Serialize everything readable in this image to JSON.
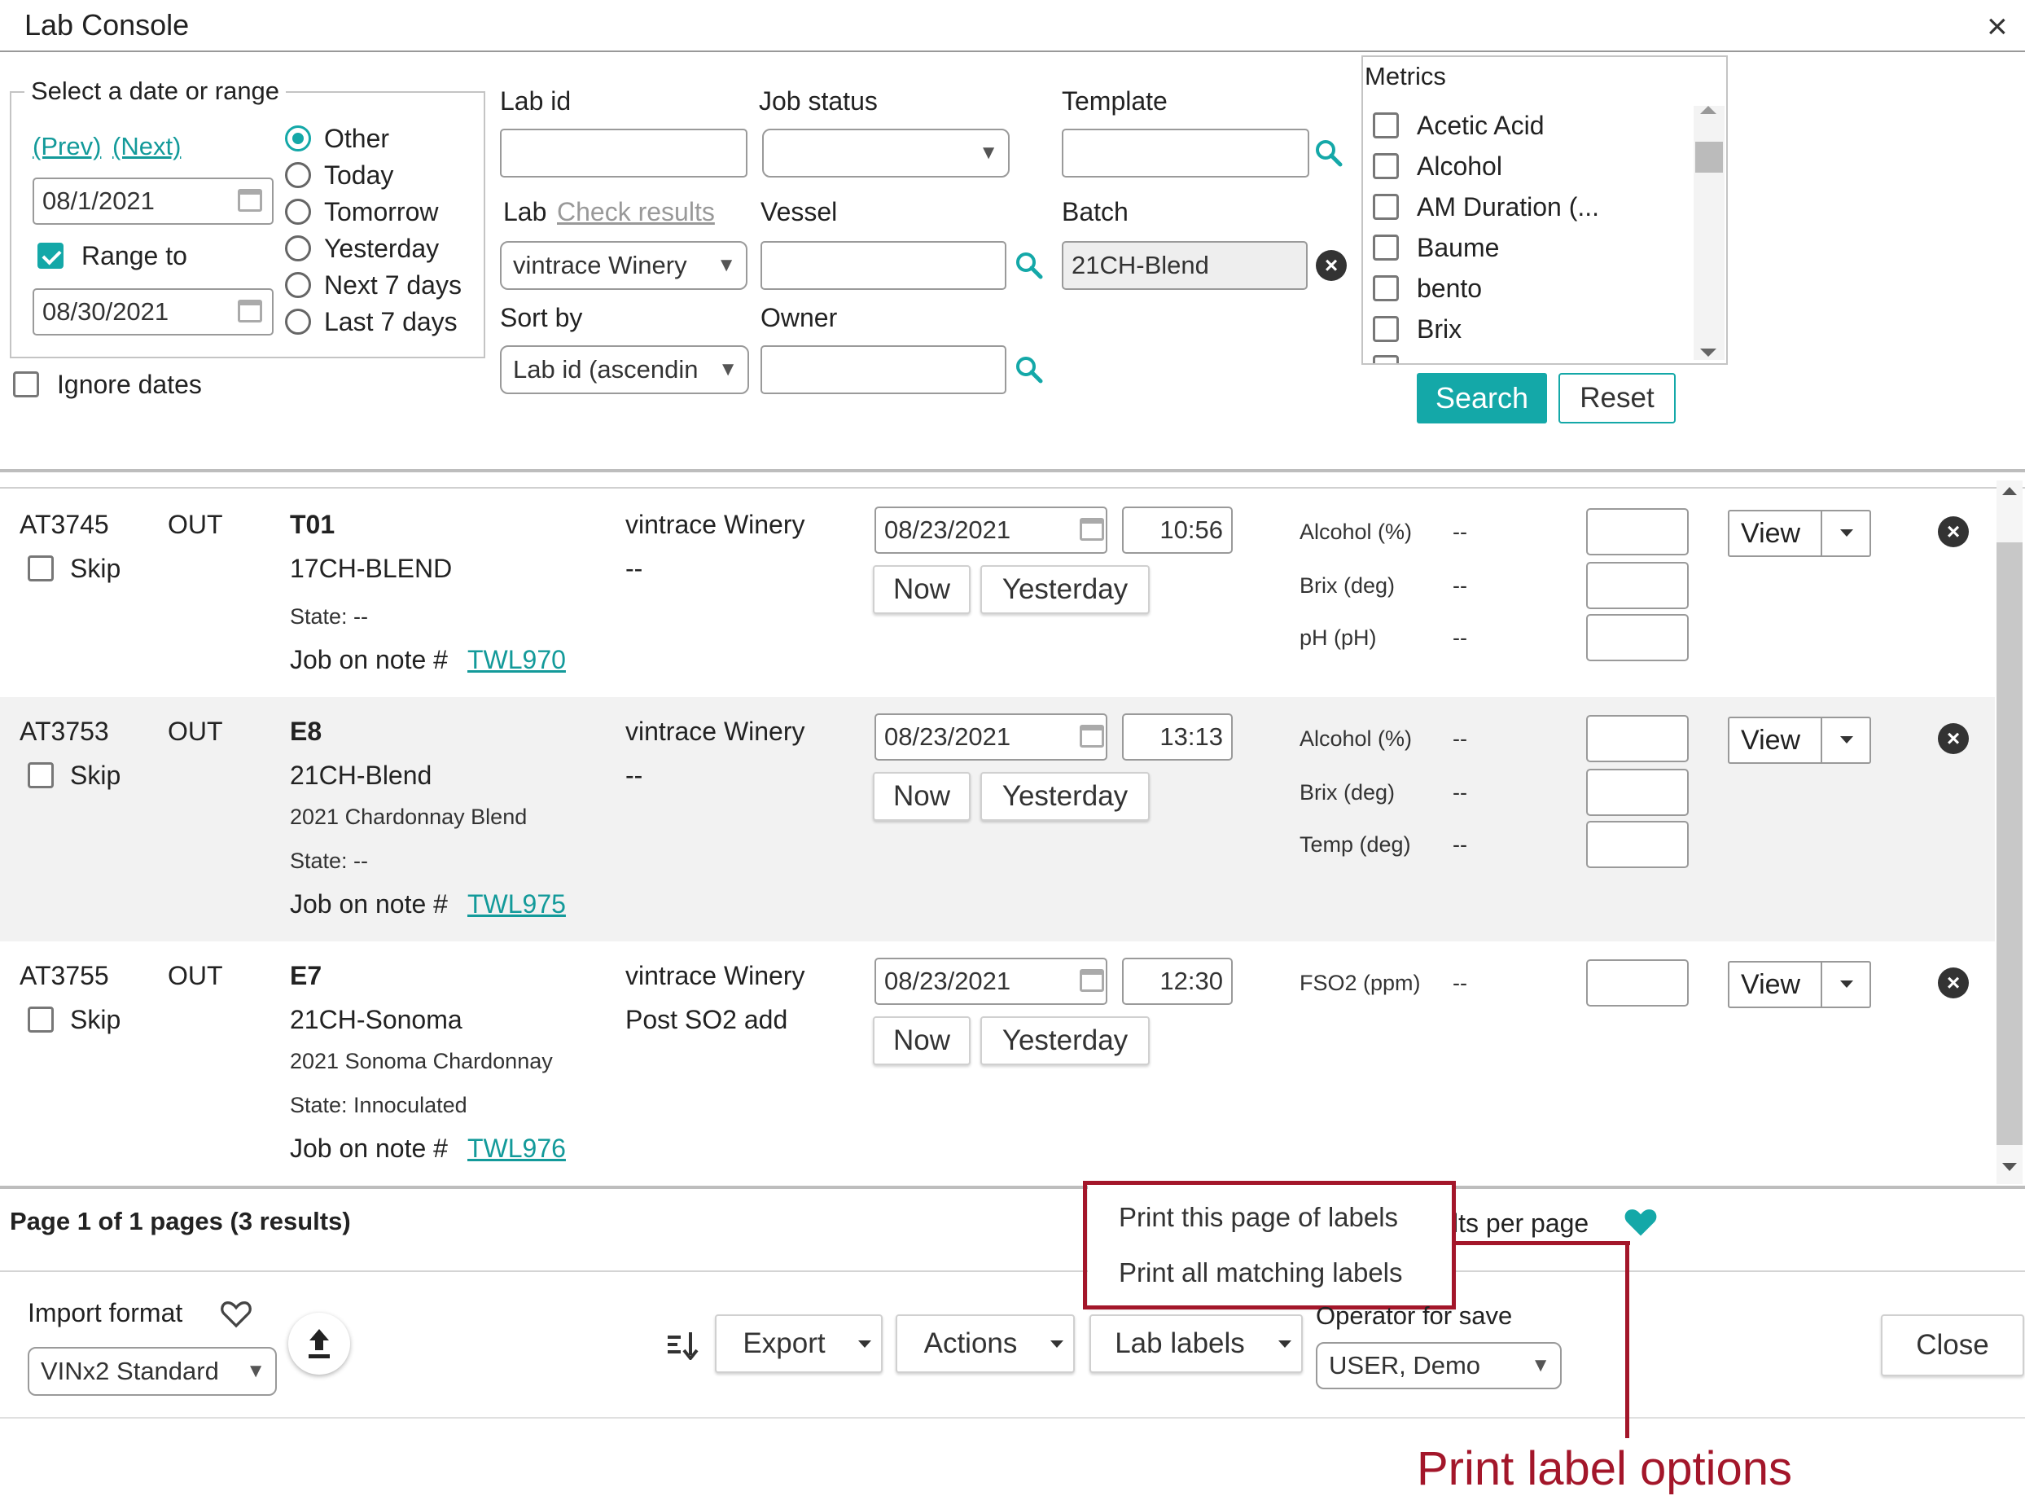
{
  "window": {
    "title": "Lab Console",
    "close_glyph": "×"
  },
  "filters": {
    "date_legend": "Select a date or range",
    "prev": "(Prev)",
    "next": "(Next)",
    "from_date": "08/1/2021",
    "range_to_label": "Range to",
    "to_date": "08/30/2021",
    "ignore_dates_label": "Ignore dates",
    "radios": [
      "Other",
      "Today",
      "Tomorrow",
      "Yesterday",
      "Next 7 days",
      "Last 7 days"
    ],
    "lab_id_label": "Lab id",
    "lab_id_value": "",
    "job_status_label": "Job status",
    "template_label": "Template",
    "lab_label": "Lab",
    "check_results_link": "Check results",
    "lab_value": "vintrace Winery",
    "vessel_label": "Vessel",
    "batch_label": "Batch",
    "batch_value": "21CH-Blend",
    "sort_by_label": "Sort by",
    "sort_by_value": "Lab id (ascendin",
    "owner_label": "Owner",
    "metrics_label": "Metrics",
    "metrics": [
      "Acetic Acid",
      "Alcohol",
      "AM Duration (...",
      "Baume",
      "bento",
      "Brix"
    ],
    "search_button": "Search",
    "reset_button": "Reset"
  },
  "rows": [
    {
      "lab_id": "AT3745",
      "direction": "OUT",
      "skip": "Skip",
      "vessel": "T01",
      "batch": "17CH-BLEND",
      "description": "",
      "state": "State: --",
      "job_note_prefix": "Job on note #",
      "job_note": "TWL970",
      "winery": "vintrace Winery",
      "winery_note": "--",
      "date": "08/23/2021",
      "time": "10:56",
      "now": "Now",
      "yesterday": "Yesterday",
      "metrics": [
        {
          "name": "Alcohol (%)",
          "value": "--"
        },
        {
          "name": "Brix (deg)",
          "value": "--"
        },
        {
          "name": "pH (pH)",
          "value": "--"
        }
      ],
      "view": "View"
    },
    {
      "lab_id": "AT3753",
      "direction": "OUT",
      "skip": "Skip",
      "vessel": "E8",
      "batch": "21CH-Blend",
      "description": "2021 Chardonnay Blend",
      "state": "State: --",
      "job_note_prefix": "Job on note #",
      "job_note": "TWL975",
      "winery": "vintrace Winery",
      "winery_note": "--",
      "date": "08/23/2021",
      "time": "13:13",
      "now": "Now",
      "yesterday": "Yesterday",
      "metrics": [
        {
          "name": "Alcohol (%)",
          "value": "--"
        },
        {
          "name": "Brix (deg)",
          "value": "--"
        },
        {
          "name": "Temp (deg)",
          "value": "--"
        }
      ],
      "view": "View"
    },
    {
      "lab_id": "AT3755",
      "direction": "OUT",
      "skip": "Skip",
      "vessel": "E7",
      "batch": "21CH-Sonoma",
      "description": "2021 Sonoma Chardonnay",
      "state": "State: Innoculated",
      "job_note_prefix": "Job on note #",
      "job_note": "TWL976",
      "winery": "vintrace Winery",
      "winery_note": "Post SO2 add",
      "date": "08/23/2021",
      "time": "12:30",
      "now": "Now",
      "yesterday": "Yesterday",
      "metrics": [
        {
          "name": "FSO2 (ppm)",
          "value": "--"
        }
      ],
      "view": "View"
    }
  ],
  "pager": {
    "summary": "Page 1 of 1 pages (3 results)",
    "results_per_page_fragment": "lts per page"
  },
  "label_menu": {
    "item1": "Print this page of labels",
    "item2": "Print all matching labels"
  },
  "footer": {
    "import_format_label": "Import format",
    "import_format_value": "VINx2 Standard",
    "export_button": "Export",
    "actions_button": "Actions",
    "lab_labels_button": "Lab labels",
    "operator_label": "Operator for save",
    "operator_value": "USER, Demo",
    "close_button": "Close"
  },
  "annotation": {
    "text": "Print label options",
    "color": "#a3162a"
  },
  "colors": {
    "accent": "#14a8a8",
    "annotation": "#a3162a"
  }
}
